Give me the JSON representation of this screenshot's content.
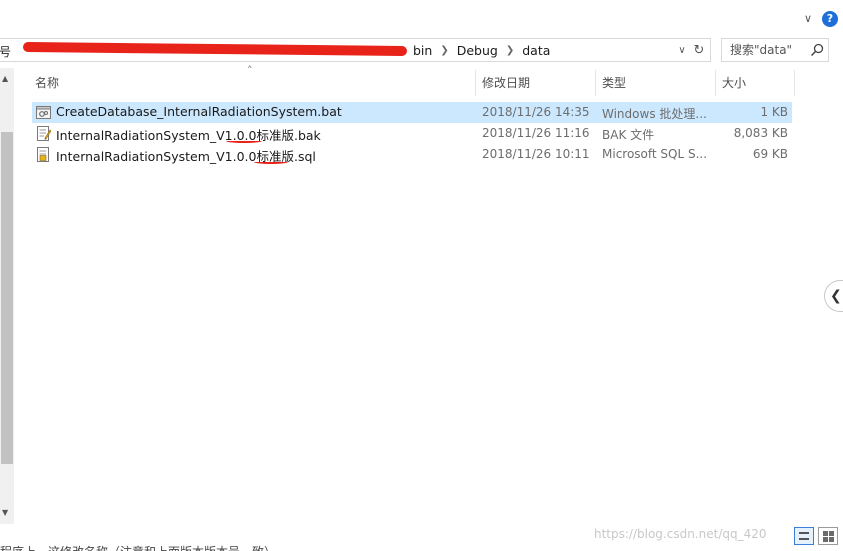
{
  "ribbon": {
    "collapse_icon": "chevron-down-icon",
    "help_icon": "help-icon",
    "help_label": "?"
  },
  "address": {
    "prefix": "号",
    "crumbs": [
      "bin",
      "Debug",
      "data"
    ],
    "dropdown_icon": "chevron-down-icon",
    "refresh_icon": "refresh-icon"
  },
  "search": {
    "placeholder": "搜索\"data\"",
    "icon": "search-icon"
  },
  "columns": {
    "name": "名称",
    "date": "修改日期",
    "type": "类型",
    "size": "大小"
  },
  "files": [
    {
      "name": "CreateDatabase_InternalRadiationSystem.bat",
      "date": "2018/11/26 14:35",
      "type": "Windows 批处理...",
      "size": "1 KB",
      "icon": "batch-file-icon",
      "selected": true
    },
    {
      "name": "InternalRadiationSystem_V1.0.0标准版.bak",
      "date": "2018/11/26 11:16",
      "type": "BAK 文件",
      "size": "8,083 KB",
      "icon": "bak-file-icon",
      "selected": false
    },
    {
      "name": "InternalRadiationSystem_V1.0.0标准版.sql",
      "date": "2018/11/26 10:11",
      "type": "Microsoft SQL S...",
      "size": "69 KB",
      "icon": "sql-file-icon",
      "selected": false
    }
  ],
  "status": {
    "behind_text": "程序上，这修改名称（注意和上面版本版本号一致）",
    "watermark": "https://blog.csdn.net/qq_420"
  },
  "colors": {
    "selection": "#cce8ff",
    "accent": "#1e6fd9",
    "redaction": "#e8231a"
  }
}
